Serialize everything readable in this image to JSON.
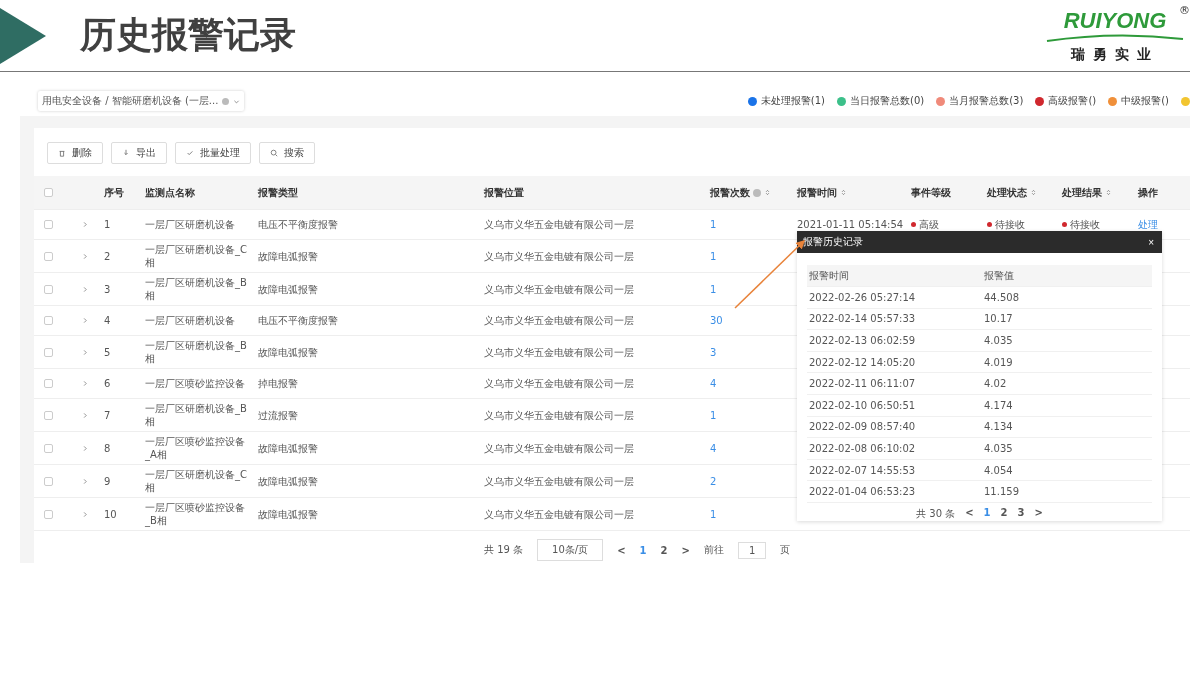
{
  "slide": {
    "title": "历史报警记录",
    "logo": {
      "brand": "RUIYONG",
      "mark": "®",
      "subtitle": "瑞勇实业"
    }
  },
  "filter": {
    "value": "用电安全设备 / 智能研磨机设备 (一层..."
  },
  "stats": [
    {
      "label": "未处理报警(1)",
      "color": "#1a73e8"
    },
    {
      "label": "当日报警总数(0)",
      "color": "#3cc08a"
    },
    {
      "label": "当月报警总数(3)",
      "color": "#f08a7a"
    },
    {
      "label": "高级报警()",
      "color": "#d0282e"
    },
    {
      "label": "中级报警()",
      "color": "#f0903a"
    },
    {
      "color": "#f2c530"
    }
  ],
  "toolbar": [
    "删除",
    "导出",
    "批量处理",
    "搜索"
  ],
  "table": {
    "select_all": {
      "checked": false
    },
    "columns": [
      {
        "label": "序号",
        "sortable": false,
        "info": false
      },
      {
        "label": "监测点名称",
        "sortable": false,
        "info": false
      },
      {
        "label": "报警类型",
        "sortable": false,
        "info": false
      },
      {
        "label": "报警位置",
        "sortable": false,
        "info": false
      },
      {
        "label": "报警次数",
        "sortable": true,
        "info": true
      },
      {
        "label": "报警时间",
        "sortable": true,
        "info": false
      },
      {
        "label": "事件等级",
        "sortable": false,
        "info": false
      },
      {
        "label": "处理状态",
        "sortable": true,
        "info": false
      },
      {
        "label": "处理结果",
        "sortable": true,
        "info": false
      },
      {
        "label": "操作",
        "sortable": false,
        "info": false
      }
    ],
    "rows": [
      {
        "checked": false,
        "index": "1",
        "name": "一层厂区研磨机设备",
        "type": "电压不平衡度报警",
        "location": "义乌市义华五金电镀有限公司一层",
        "count": "1",
        "time": "2021-01-11 05:14:54",
        "level": "高级",
        "status": "待接收",
        "result": "待接收",
        "action": "处理"
      },
      {
        "checked": false,
        "index": "2",
        "name": "一层厂区研磨机设备_C相",
        "type": "故障电弧报警",
        "location": "义乌市义华五金电镀有限公司一层",
        "count": "1"
      },
      {
        "checked": false,
        "index": "3",
        "name": "一层厂区研磨机设备_B相",
        "type": "故障电弧报警",
        "location": "义乌市义华五金电镀有限公司一层",
        "count": "1"
      },
      {
        "checked": false,
        "index": "4",
        "name": "一层厂区研磨机设备",
        "type": "电压不平衡度报警",
        "location": "义乌市义华五金电镀有限公司一层",
        "count": "30"
      },
      {
        "checked": false,
        "index": "5",
        "name": "一层厂区研磨机设备_B相",
        "type": "故障电弧报警",
        "location": "义乌市义华五金电镀有限公司一层",
        "count": "3"
      },
      {
        "checked": false,
        "index": "6",
        "name": "一层厂区喷砂监控设备",
        "type": "掉电报警",
        "location": "义乌市义华五金电镀有限公司一层",
        "count": "4"
      },
      {
        "checked": false,
        "index": "7",
        "name": "一层厂区研磨机设备_B相",
        "type": "过流报警",
        "location": "义乌市义华五金电镀有限公司一层",
        "count": "1"
      },
      {
        "checked": false,
        "index": "8",
        "name": "一层厂区喷砂监控设备_A相",
        "type": "故障电弧报警",
        "location": "义乌市义华五金电镀有限公司一层",
        "count": "4"
      },
      {
        "checked": false,
        "index": "9",
        "name": "一层厂区研磨机设备_C相",
        "type": "故障电弧报警",
        "location": "义乌市义华五金电镀有限公司一层",
        "count": "2"
      },
      {
        "checked": false,
        "index": "10",
        "name": "一层厂区喷砂监控设备_B相",
        "type": "故障电弧报警",
        "location": "义乌市义华五金电镀有限公司一层",
        "count": "1"
      }
    ]
  },
  "pagination": {
    "total": "共 19 条",
    "page_size": "10条/页",
    "prev": "<",
    "pages": [
      {
        "label": "1",
        "selected": true
      },
      {
        "label": "2",
        "selected": false
      }
    ],
    "next": ">",
    "goto_label": "前往",
    "goto_value": "1",
    "goto_suffix": "页"
  },
  "popup": {
    "title": "报警历史记录",
    "close": "×",
    "columns": [
      "报警时间",
      "报警值"
    ],
    "rows": [
      [
        "2022-02-26 05:27:14",
        "44.508"
      ],
      [
        "2022-02-14 05:57:33",
        "10.17"
      ],
      [
        "2022-02-13 06:02:59",
        "4.035"
      ],
      [
        "2022-02-12 14:05:20",
        "4.019"
      ],
      [
        "2022-02-11 06:11:07",
        "4.02"
      ],
      [
        "2022-02-10 06:50:51",
        "4.174"
      ],
      [
        "2022-02-09 08:57:40",
        "4.134"
      ],
      [
        "2022-02-08 06:10:02",
        "4.035"
      ],
      [
        "2022-02-07 14:55:53",
        "4.054"
      ],
      [
        "2022-01-04 06:53:23",
        "11.159"
      ]
    ],
    "pagination": {
      "total": "共 30 条",
      "prev": "<",
      "pages": [
        {
          "label": "1",
          "selected": true
        },
        {
          "label": "2",
          "selected": false
        },
        {
          "label": "3",
          "selected": false
        }
      ],
      "next": ">"
    }
  }
}
